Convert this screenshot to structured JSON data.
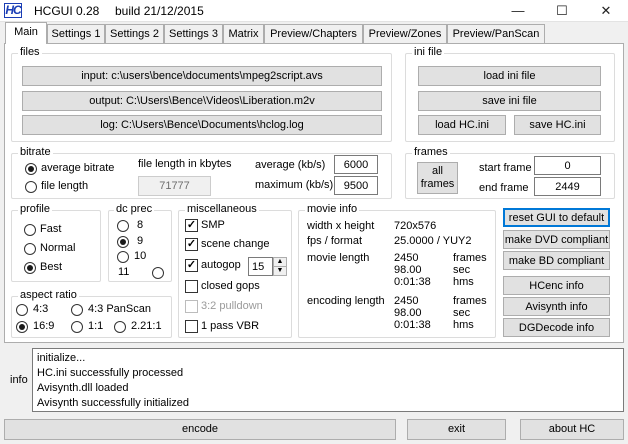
{
  "window": {
    "icon_text": "HC",
    "title": "HCGUI 0.28",
    "build": "build 21/12/2015",
    "min_glyph": "—",
    "max_glyph": "☐",
    "close_glyph": "✕"
  },
  "tabs": [
    "Main",
    "Settings 1",
    "Settings 2",
    "Settings 3",
    "Matrix",
    "Preview/Chapters",
    "Preview/Zones",
    "Preview/PanScan"
  ],
  "files": {
    "label": "files",
    "input": "input: c:\\users\\bence\\documents\\mpeg2script.avs",
    "output": "output: C:\\Users\\Bence\\Videos\\Liberation.m2v",
    "log": "log: C:\\Users\\Bence\\Documents\\hclog.log"
  },
  "ini": {
    "label": "ini file",
    "load": "load ini file",
    "save": "save ini file",
    "load_hc": "load HC.ini",
    "save_hc": "save HC.ini"
  },
  "bitrate": {
    "label": "bitrate",
    "avg_option": "average bitrate",
    "file_option": "file length",
    "file_len_label": "file length in kbytes",
    "file_len_value": "71777",
    "avg_label": "average (kb/s)",
    "avg_value": "6000",
    "max_label": "maximum (kb/s)",
    "max_value": "9500"
  },
  "frames": {
    "label": "frames",
    "all_line1": "all",
    "all_line2": "frames",
    "start_label": "start frame",
    "start_value": "0",
    "end_label": "end frame",
    "end_value": "2449"
  },
  "profile": {
    "label": "profile",
    "options": [
      "Fast",
      "Normal",
      "Best"
    ]
  },
  "dcprec": {
    "label": "dc prec",
    "options": [
      "8",
      "9",
      "10",
      "11"
    ]
  },
  "misc": {
    "label": "miscellaneous",
    "smp": "SMP",
    "scene_change": "scene change",
    "autogop": "autogop",
    "autogop_value": "15",
    "closed_gops": "closed gops",
    "pulldown": "3:2 pulldown",
    "one_pass": "1 pass VBR",
    "check_glyph": "✓"
  },
  "movie": {
    "label": "movie info",
    "wh_label": "width x height",
    "wh_value": "720x576",
    "fps_label": "fps / format",
    "fps_value": "25.0000 / YUY2",
    "len_label": "movie length",
    "len_v1": "2450",
    "len_v2": "98.00",
    "len_v3": "0:01:38",
    "enc_label": "encoding length",
    "enc_v1": "2450",
    "enc_v2": "98.00",
    "enc_v3": "0:01:38",
    "u1": "frames",
    "u2": "sec",
    "u3": "hms"
  },
  "actions": {
    "reset": "reset GUI to default",
    "dvd": "make DVD compliant",
    "bd": "make BD compliant",
    "hcenc": "HCenc info",
    "avisynth": "Avisynth info",
    "dgdecode": "DGDecode info"
  },
  "aspect": {
    "label": "aspect ratio",
    "options": [
      "4:3",
      "4:3 PanScan",
      "16:9",
      "1:1",
      "2.21:1"
    ]
  },
  "info": {
    "label": "info",
    "lines": [
      "initialize...",
      "HC.ini successfully processed",
      "Avisynth.dll loaded",
      "Avisynth successfully initialized"
    ]
  },
  "bottom": {
    "encode": "encode",
    "exit": "exit",
    "about": "about HC"
  },
  "colors": {
    "accent": "#0078d7",
    "icon_blue": "#1a3db5"
  }
}
